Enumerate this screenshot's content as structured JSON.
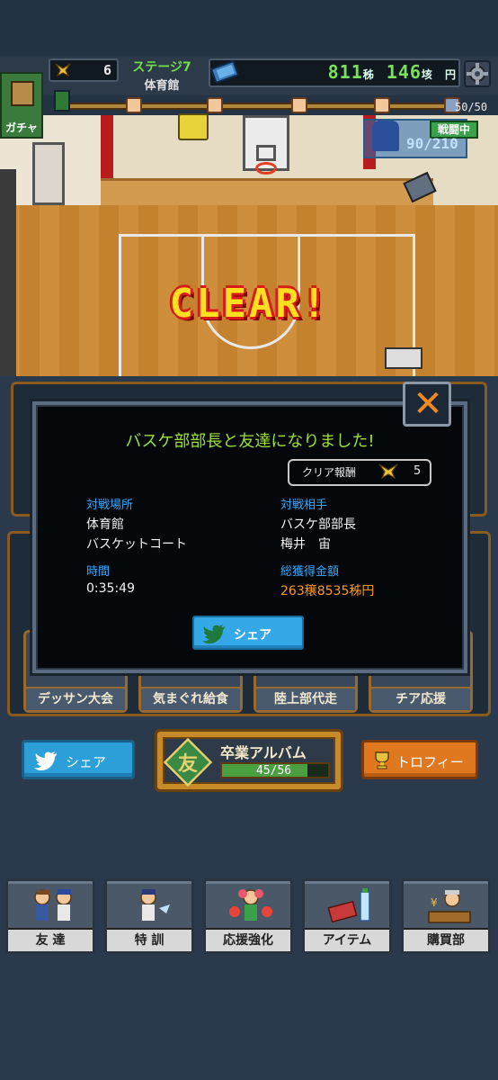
{
  "header": {
    "medal_count": "6",
    "stage_label": "ステージ7",
    "stage_place": "体育館",
    "money_main": "811",
    "money_unit1": "秭",
    "money_mid": "146",
    "money_unit2": "垓",
    "money_unit3": "円",
    "progress": "50/50",
    "progress_fraction": 1.0
  },
  "scene": {
    "gacha_label": "ガチャ",
    "enemy_hp": "90/210",
    "battle_badge": "戦闘中",
    "clear_text": "CLEAR!"
  },
  "dialog": {
    "close_symbol": "✕",
    "title": "バスケ部部長と友達になりました!",
    "reward_label": "クリア報酬",
    "reward_count": "5",
    "location_label": "対戦場所",
    "location_1": "体育館",
    "location_2": "バスケットコート",
    "opponent_label": "対戦相手",
    "opponent_1": "バスケ部部長",
    "opponent_2": "梅井　宙",
    "time_label": "時間",
    "time_value": "0:35:49",
    "money_label": "総獲得金額",
    "money_value": "263穣8535秭円",
    "share_label": "シェア"
  },
  "background_cards": [
    "デッサン大会",
    "気まぐれ給食",
    "陸上部代走",
    "チア応援"
  ],
  "actions": {
    "share_label": "シェア",
    "album_label": "卒業アルバム",
    "album_icon_text": "友",
    "album_count": "45/56",
    "album_fraction": 0.8036,
    "trophy_label": "トロフィー"
  },
  "nav": [
    {
      "label": "友 達",
      "name": "nav-friends"
    },
    {
      "label": "特 訓",
      "name": "nav-training"
    },
    {
      "label": "応援強化",
      "name": "nav-cheer-boost"
    },
    {
      "label": "アイテム",
      "name": "nav-items"
    },
    {
      "label": "購買部",
      "name": "nav-shop"
    }
  ],
  "colors": {
    "accent_green": "#9be03a",
    "info_blue": "#35a9ff",
    "money_orange": "#ff9a1e",
    "close_orange": "#f08a1e",
    "share_blue": "#35a9e8",
    "trophy_orange": "#e07820"
  }
}
